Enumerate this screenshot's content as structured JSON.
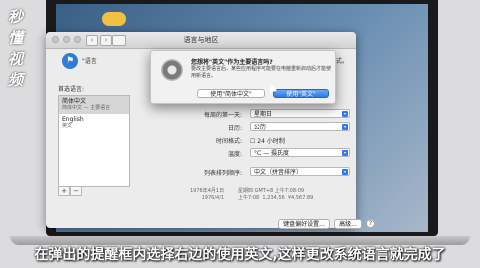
{
  "watermark": {
    "logo_text": "秒懂视频"
  },
  "window": {
    "title": "语言与地区",
    "nav_back": "‹",
    "nav_forward": "›",
    "intro_text": "\"语言",
    "intro_text_right": "你的格式。",
    "preferred_label": "首选语言:",
    "languages": [
      {
        "name": "简体中文",
        "sub": "简体中文 — 主要语言"
      },
      {
        "name": "English",
        "sub": "英文"
      }
    ],
    "add_label": "+",
    "remove_label": "−",
    "rows": [
      {
        "label": "每周的第一天:",
        "value": "星期日"
      },
      {
        "label": "日历:",
        "value": "公历"
      },
      {
        "label": "时间格式:",
        "value": "24 小时制",
        "checkbox": true
      },
      {
        "label": "温度:",
        "value": "°C — 摄氏度"
      },
      {
        "label": "列表排列顺序:",
        "value": "中文（拼音排序）"
      }
    ],
    "sample_left": [
      "1976年4月1日",
      "1976/4/1"
    ],
    "sample_right": [
      "星期四 GMT+8 上午7:08:09",
      "上午7:08",
      "1,234,56",
      "¥4,567.89"
    ],
    "keyboard_button": "键盘偏好设置...",
    "advanced_button": "高级...",
    "help_label": "?"
  },
  "dialog": {
    "title": "您想将\"英文\"作为主要语言吗?",
    "body": "要改主要语言后，某些应用程序可能要在电脑重新启动后才能使用新语言。",
    "secondary_button": "使用\"简体中文\"",
    "primary_button": "使用\"英文\""
  },
  "subtitle": "在弹出的提醒框内选择右边的使用英文,这样更改系统语言就完成了"
}
